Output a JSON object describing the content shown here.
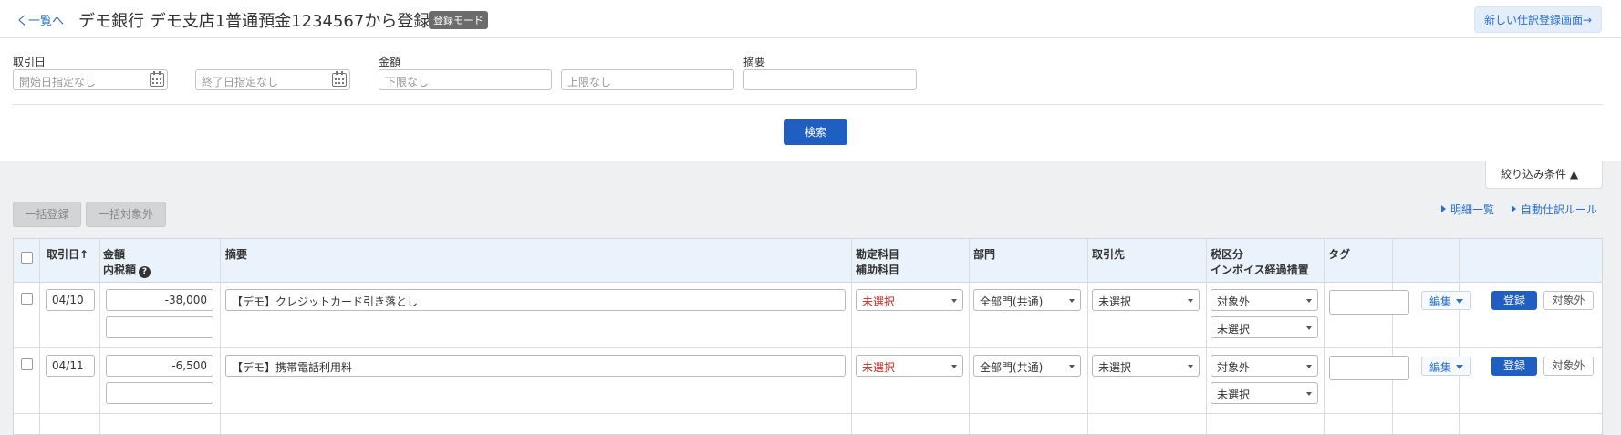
{
  "header": {
    "back_label": "く一覧へ",
    "title": "デモ銀行 デモ支店1普通預金1234567から登録",
    "mode_badge": "登録モード",
    "new_journal_button": "新しい仕訳登録画面→"
  },
  "filter": {
    "date_label": "取引日",
    "date_start_placeholder": "開始日指定なし",
    "date_end_placeholder": "終了日指定なし",
    "amount_label": "金額",
    "amount_min_placeholder": "下限なし",
    "amount_max_placeholder": "上限なし",
    "memo_label": "摘要",
    "memo_value": "",
    "search_button": "検索",
    "toggle_label": "絞り込み条件 ▲"
  },
  "toolbar": {
    "bulk_register": "一括登録",
    "bulk_exclude": "一括対象外",
    "details_link": "明細一覧",
    "auto_rule_link": "自動仕訳ルール"
  },
  "table": {
    "headers": {
      "date": "取引日↑",
      "amount": "金額",
      "tax_included": "内税額",
      "memo": "摘要",
      "account": "勘定科目",
      "sub_account": "補助科目",
      "department": "部門",
      "partner": "取引先",
      "tax": "税区分",
      "invoice": "インボイス経過措置",
      "tag": "タグ"
    },
    "rows": [
      {
        "date": "04/10",
        "amount": "-38,000",
        "tax_amount": "",
        "memo": "【デモ】クレジットカード引き落とし",
        "account": "未選択",
        "department": "全部門(共通)",
        "partner": "未選択",
        "tax": "対象外",
        "invoice": "未選択",
        "tag": "",
        "edit": "編集",
        "register": "登録",
        "exclude": "対象外"
      },
      {
        "date": "04/11",
        "amount": "-6,500",
        "tax_amount": "",
        "memo": "【デモ】携帯電話利用料",
        "account": "未選択",
        "department": "全部門(共通)",
        "partner": "未選択",
        "tax": "対象外",
        "invoice": "未選択",
        "tag": "",
        "edit": "編集",
        "register": "登録",
        "exclude": "対象外"
      }
    ]
  }
}
